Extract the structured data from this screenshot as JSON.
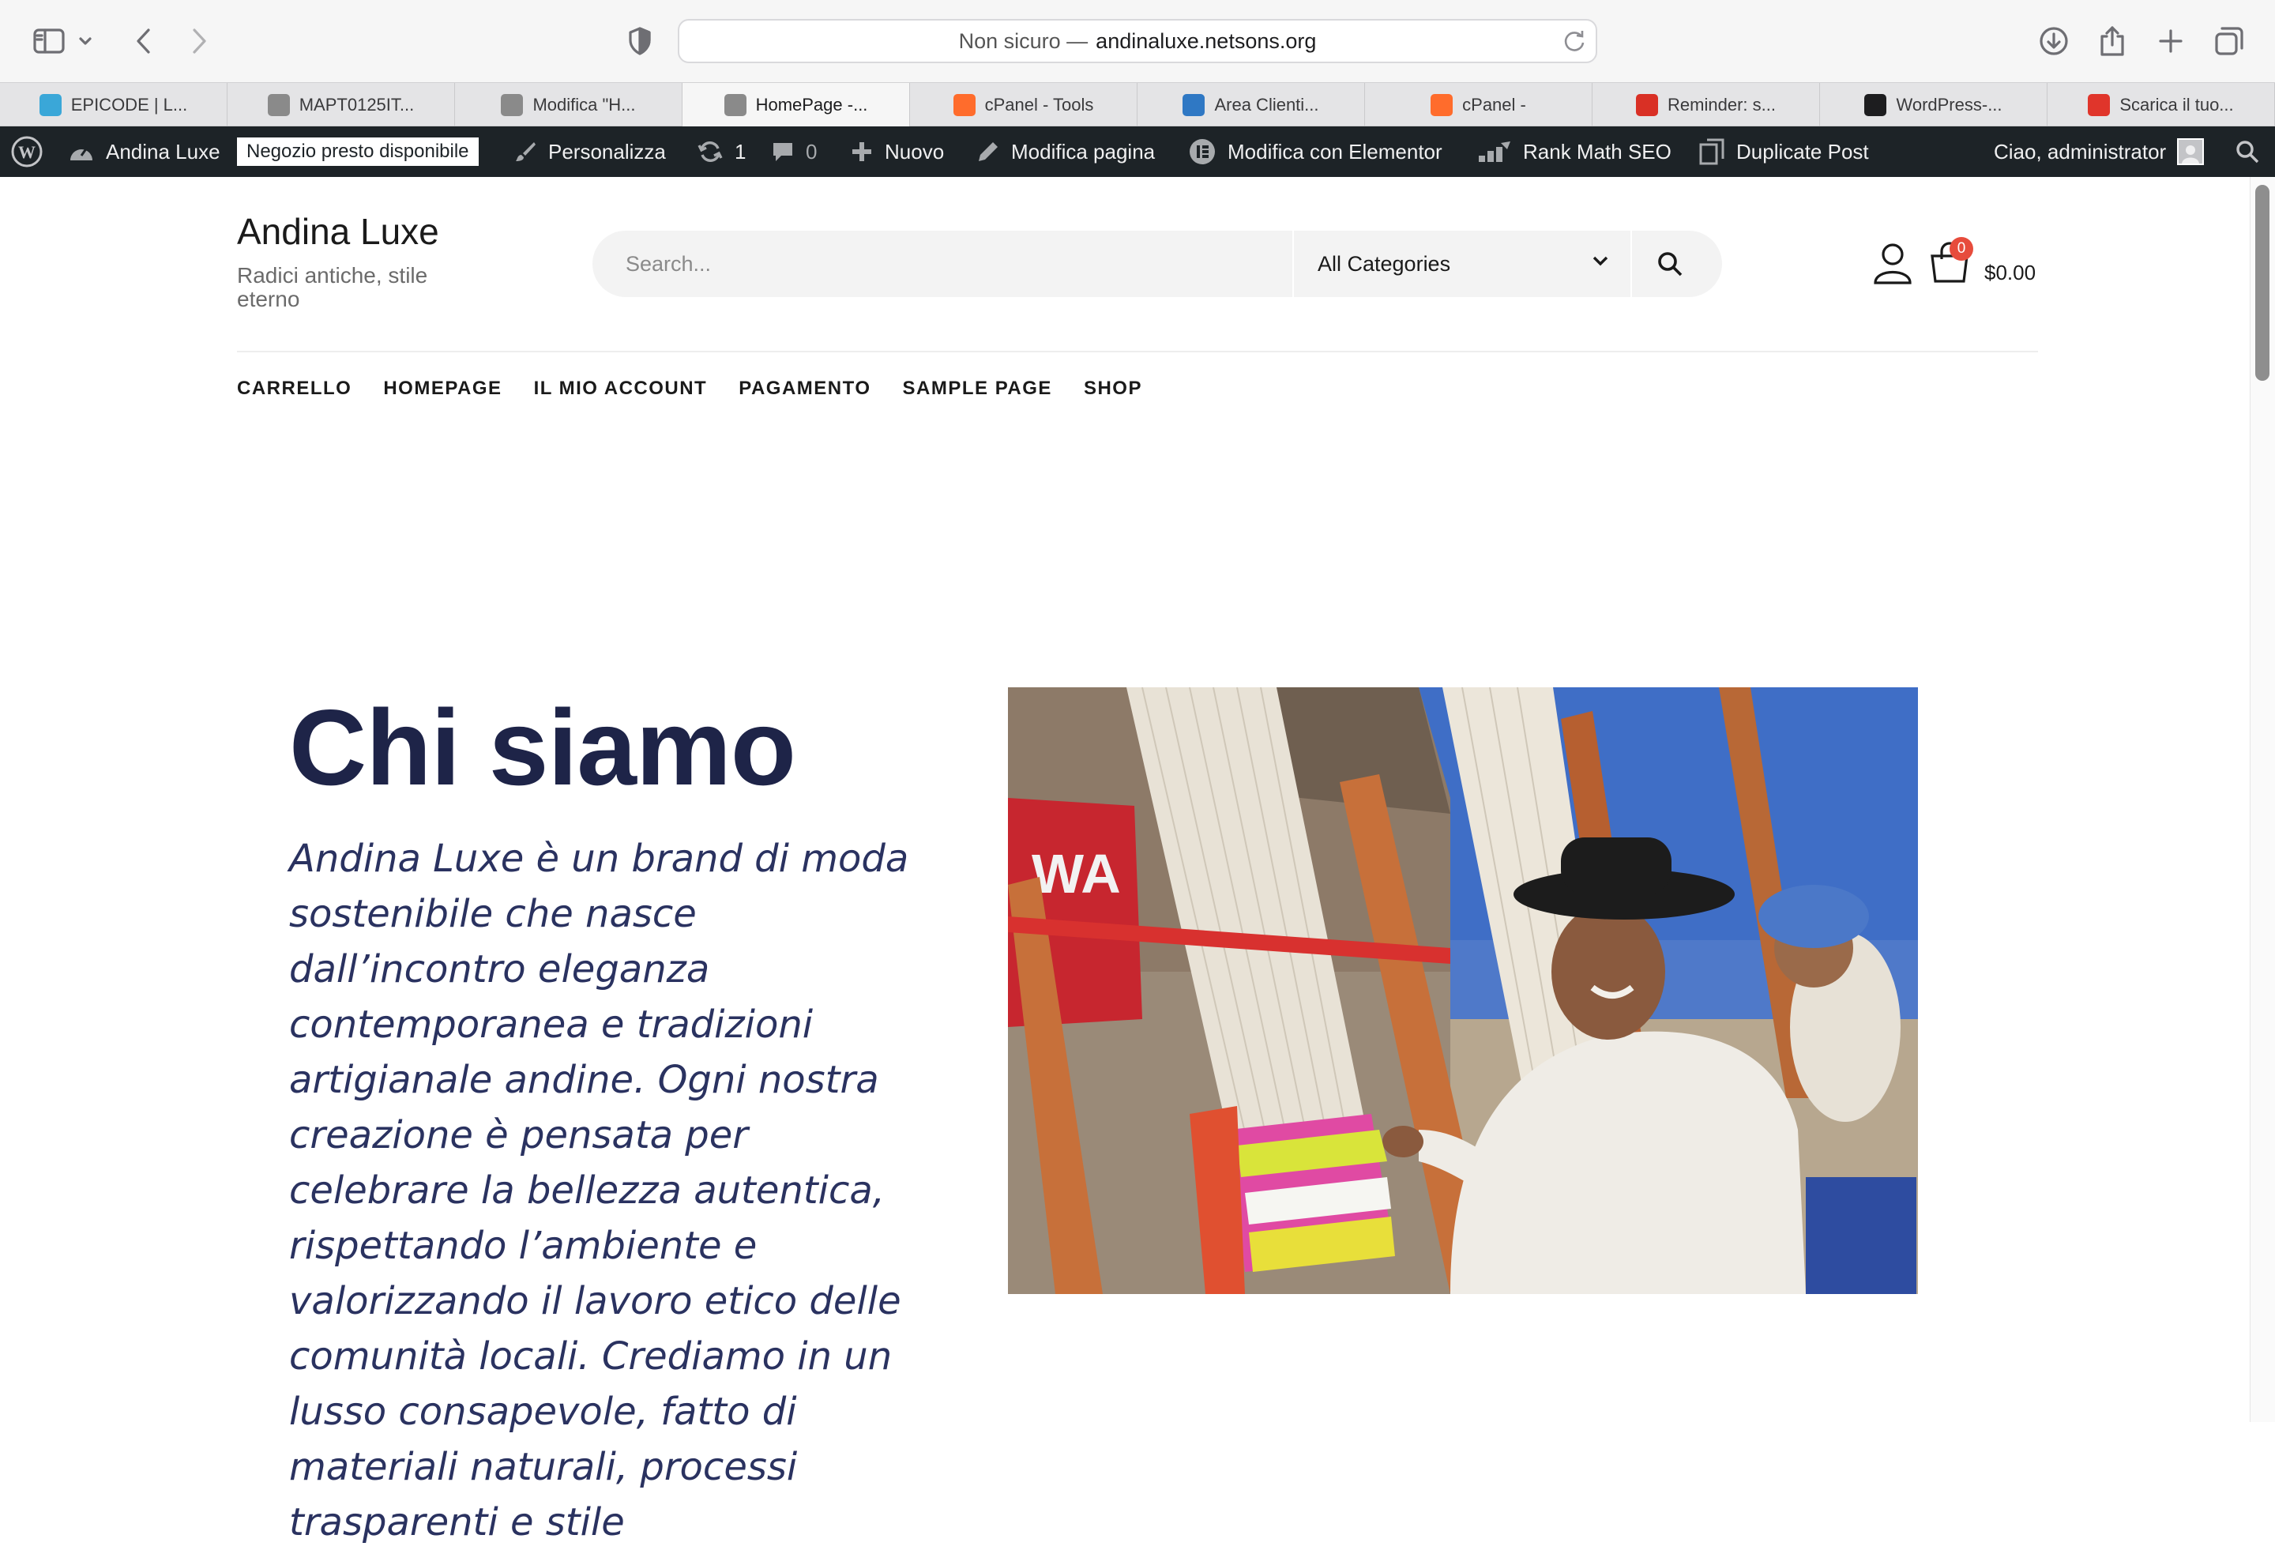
{
  "browser": {
    "address": {
      "security": "Non sicuro —",
      "host": "andinaluxe.netsons.org"
    }
  },
  "tabs": [
    {
      "label": "EPICODE | L...",
      "icon": "epicode-favicon",
      "color": "#3aa7d8"
    },
    {
      "label": "MAPT0125IT...",
      "icon": "wordpress-favicon",
      "color": "#8a8a8a"
    },
    {
      "label": "Modifica \"H...",
      "icon": "wordpress-favicon",
      "color": "#8a8a8a"
    },
    {
      "label": "HomePage -...",
      "icon": "wordpress-favicon",
      "color": "#8a8a8a",
      "active": true
    },
    {
      "label": "cPanel - Tools",
      "icon": "cpanel-favicon",
      "color": "#ff6c2c"
    },
    {
      "label": "Area Clienti...",
      "icon": "netsons-favicon",
      "color": "#2f78c4"
    },
    {
      "label": "cPanel -",
      "icon": "cpanel-favicon",
      "color": "#ff6c2c"
    },
    {
      "label": "Reminder: s...",
      "icon": "gmail-favicon",
      "color": "#d93025"
    },
    {
      "label": "WordPress-...",
      "icon": "github-favicon",
      "color": "#1d1d1f"
    },
    {
      "label": "Scarica il tuo...",
      "icon": "download-favicon",
      "color": "#e0352b"
    }
  ],
  "adminbar": {
    "site_name": "Andina Luxe",
    "store_notice": "Negozio presto disponibile",
    "customize": "Personalizza",
    "updates": "1",
    "comments": "0",
    "new": "Nuovo",
    "edit_page": "Modifica pagina",
    "elementor": "Modifica con Elementor",
    "rank_math": "Rank Math SEO",
    "duplicate": "Duplicate Post",
    "greeting": "Ciao, administrator"
  },
  "site": {
    "title": "Andina Luxe",
    "tagline": "Radici antiche, stile eterno",
    "search_placeholder": "Search...",
    "category_selected": "All Categories",
    "cart_count": "0",
    "cart_total": "$0.00"
  },
  "nav": [
    "CARRELLO",
    "HOMEPAGE",
    "IL MIO ACCOUNT",
    "PAGAMENTO",
    "SAMPLE PAGE",
    "SHOP"
  ],
  "content": {
    "heading": "Chi siamo",
    "intro": "Andina Luxe è un brand di moda sostenibile che nasce dall’incontro eleganza contemporanea e tradizioni artigianale andine. Ogni nostra creazione è pensata per celebrare la bellezza autentica, rispettando l’ambiente e valorizzando il lavoro etico delle comunità locali. Crediamo in un lusso consapevole, fatto di materiali naturali, processi trasparenti e stile"
  }
}
